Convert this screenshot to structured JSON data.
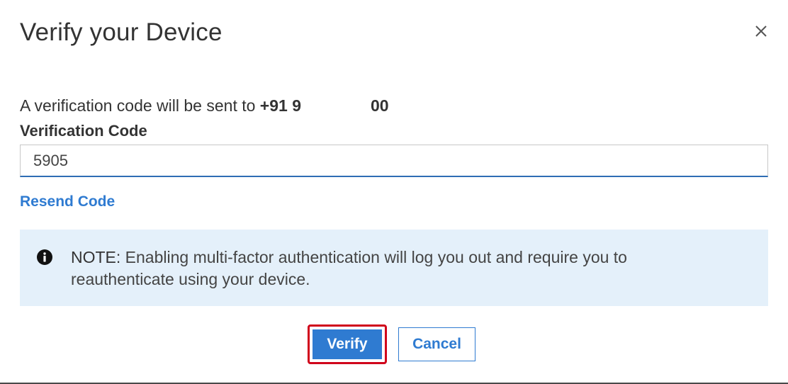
{
  "dialog": {
    "title": "Verify your Device",
    "close_icon": "close-icon"
  },
  "verification": {
    "sent_text": "A verification code will be sent to ",
    "phone_prefix": "+91 9",
    "phone_suffix": "00",
    "field_label": "Verification Code",
    "input_value": "5905",
    "resend_label": "Resend Code"
  },
  "note": {
    "icon": "info-icon",
    "label": "NOTE:",
    "text": " Enabling multi-factor authentication will log you out and require you to reauthenticate using your device."
  },
  "actions": {
    "verify_label": "Verify",
    "cancel_label": "Cancel"
  },
  "colors": {
    "accent": "#2f7bd1",
    "note_background": "#e4f0fa",
    "highlight_outline": "#d0021b"
  }
}
